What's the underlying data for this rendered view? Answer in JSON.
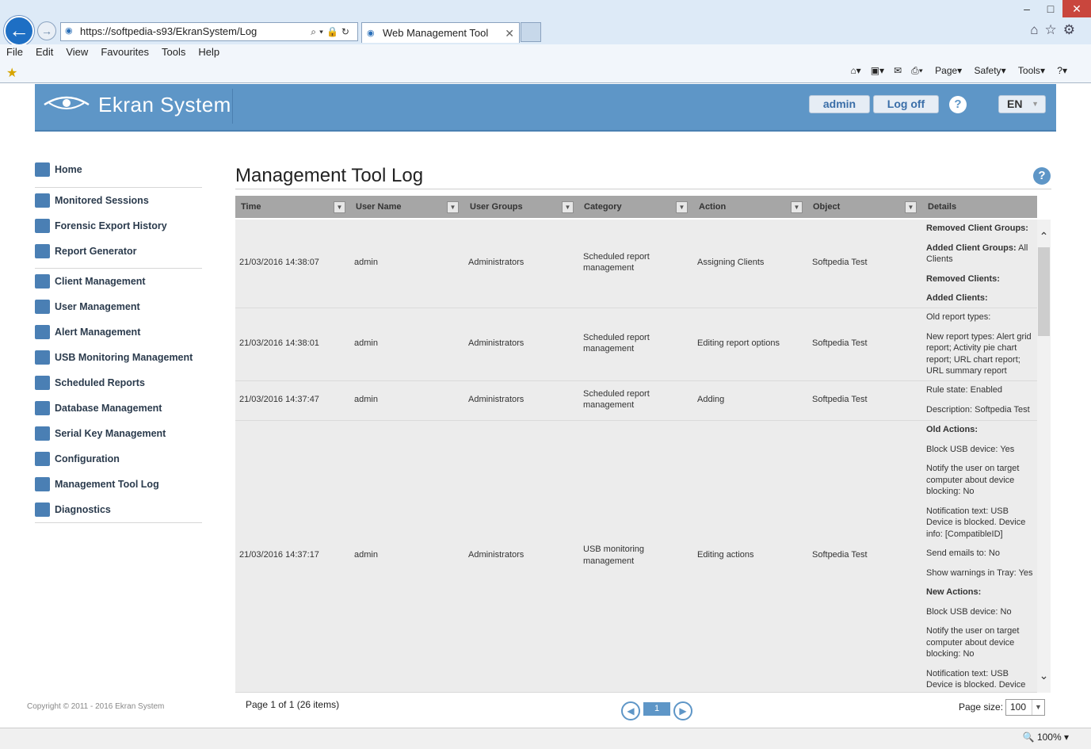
{
  "browser": {
    "url": "https://softpedia-s93/EkranSystem/Log",
    "tab_title": "Web Management Tool",
    "menu": [
      "File",
      "Edit",
      "View",
      "Favourites",
      "Tools",
      "Help"
    ],
    "cmd": {
      "page": "Page",
      "safety": "Safety",
      "tools": "Tools"
    },
    "zoom": "100%"
  },
  "header": {
    "logo": "Ekran System",
    "user": "admin",
    "logoff": "Log off",
    "help": "?",
    "lang": "EN"
  },
  "sidebar": {
    "items": [
      {
        "label": "Home",
        "icon": "home-icon"
      },
      {
        "label": "Monitored Sessions",
        "icon": "monitor-icon"
      },
      {
        "label": "Forensic Export History",
        "icon": "film-icon"
      },
      {
        "label": "Report Generator",
        "icon": "report-icon"
      },
      {
        "label": "Client Management",
        "icon": "client-icon"
      },
      {
        "label": "User Management",
        "icon": "users-icon"
      },
      {
        "label": "Alert Management",
        "icon": "alert-icon"
      },
      {
        "label": "USB Monitoring Management",
        "icon": "usb-icon"
      },
      {
        "label": "Scheduled Reports",
        "icon": "clock-icon"
      },
      {
        "label": "Database Management",
        "icon": "database-icon"
      },
      {
        "label": "Serial Key Management",
        "icon": "key-icon"
      },
      {
        "label": "Configuration",
        "icon": "gear-icon"
      },
      {
        "label": "Management Tool Log",
        "icon": "log-icon"
      },
      {
        "label": "Diagnostics",
        "icon": "diagnostics-icon"
      }
    ],
    "copyright": "Copyright © 2011 - 2016 Ekran System"
  },
  "main": {
    "title": "Management Tool Log",
    "columns": [
      "Time",
      "User Name",
      "User Groups",
      "Category",
      "Action",
      "Object",
      "Details"
    ],
    "rows": [
      {
        "time": "21/03/2016 14:38:07",
        "user": "admin",
        "group": "Administrators",
        "category": "Scheduled report management",
        "action": "Assigning Clients",
        "object": "Softpedia Test",
        "details": [
          {
            "b": "Removed Client Groups:",
            "t": ""
          },
          {
            "b": "Added Client Groups:",
            "t": " All Clients"
          },
          {
            "b": "Removed Clients:",
            "t": ""
          },
          {
            "b": "Added Clients:",
            "t": ""
          }
        ]
      },
      {
        "time": "21/03/2016 14:38:01",
        "user": "admin",
        "group": "Administrators",
        "category": "Scheduled report management",
        "action": "Editing report options",
        "object": "Softpedia Test",
        "details": [
          {
            "b": "",
            "t": "Old report types:"
          },
          {
            "b": "",
            "t": "New report types: Alert grid report; Activity pie chart report; URL chart report; URL summary report"
          }
        ]
      },
      {
        "time": "21/03/2016 14:37:47",
        "user": "admin",
        "group": "Administrators",
        "category": "Scheduled report management",
        "action": "Adding",
        "object": "Softpedia Test",
        "details": [
          {
            "b": "",
            "t": "Rule state: Enabled"
          },
          {
            "b": "",
            "t": "Description: Softpedia Test"
          }
        ]
      },
      {
        "time": "21/03/2016 14:37:17",
        "user": "admin",
        "group": "Administrators",
        "category": "USB monitoring management",
        "action": "Editing actions",
        "object": "Softpedia Test",
        "details": [
          {
            "b": "Old Actions:",
            "t": ""
          },
          {
            "b": "",
            "t": "Block USB device: Yes"
          },
          {
            "b": "",
            "t": "Notify the user on target computer about device blocking: No"
          },
          {
            "b": "",
            "t": "Notification text: USB Device is blocked. Device info: [CompatibleID]"
          },
          {
            "b": "",
            "t": "Send emails to: No"
          },
          {
            "b": "",
            "t": "Show warnings in Tray: Yes"
          },
          {
            "b": "New Actions:",
            "t": ""
          },
          {
            "b": "",
            "t": "Block USB device: No"
          },
          {
            "b": "",
            "t": "Notify the user on target computer about device blocking: No"
          },
          {
            "b": "",
            "t": "Notification text: USB Device is blocked. Device info: [CompatibleID]"
          }
        ]
      }
    ],
    "pager": {
      "info": "Page 1 of 1 (26 items)",
      "current": "1",
      "size_label": "Page size:",
      "size": "100"
    }
  }
}
